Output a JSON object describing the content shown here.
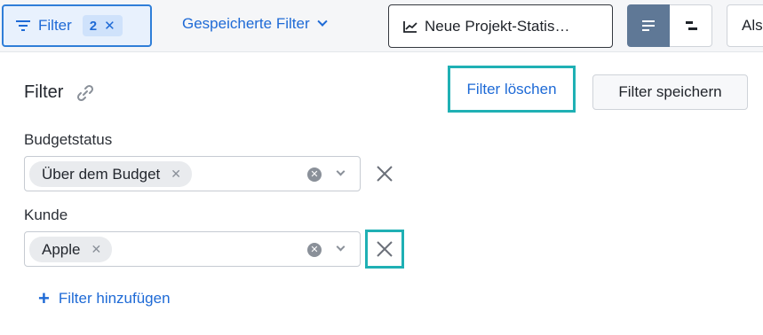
{
  "toolbar": {
    "filter_label": "Filter",
    "filter_count": "2",
    "filter_count_clear": "✕",
    "saved_filters_label": "Gespeicherte Filter",
    "stats_button_label": "Neue Projekt-Statis…",
    "als_label": "Als"
  },
  "panel": {
    "title": "Filter",
    "clear_label": "Filter löschen",
    "save_label": "Filter speichern",
    "fields": [
      {
        "label": "Budgetstatus",
        "chip": "Über dem Budget",
        "chip_remove": "✕",
        "clear": "✕"
      },
      {
        "label": "Kunde",
        "chip": "Apple",
        "chip_remove": "✕",
        "clear": "✕"
      }
    ],
    "add_filter_label": "Filter hinzufügen",
    "add_filter_plus": "+"
  },
  "colors": {
    "accent": "#1e6ad6",
    "highlight": "#1fb0b4",
    "toggle_active": "#5f7896"
  },
  "icons": [
    "filter-icon",
    "chevron-down-icon",
    "line-chart-icon",
    "list-view-icon",
    "gantt-view-icon",
    "link-icon",
    "close-icon",
    "plus-icon"
  ]
}
